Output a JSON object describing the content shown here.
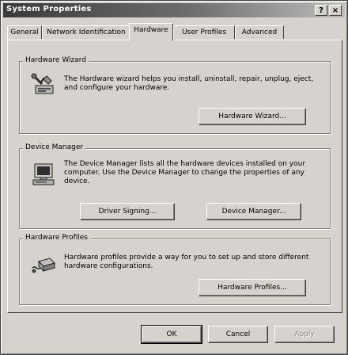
{
  "window": {
    "title": "System Properties",
    "help_label": "?",
    "close_label": "×"
  },
  "tabs": [
    {
      "label": "General",
      "active": false
    },
    {
      "label": "Network Identification",
      "active": false
    },
    {
      "label": "Hardware",
      "active": true
    },
    {
      "label": "User Profiles",
      "active": false
    },
    {
      "label": "Advanced",
      "active": false
    }
  ],
  "hardware_wizard": {
    "title": "Hardware Wizard",
    "description": "The Hardware wizard helps you install, uninstall, repair, unplug, eject, and configure your hardware.",
    "button_label": "Hardware Wizard...",
    "icon": "hardware-wizard-icon"
  },
  "device_manager": {
    "title": "Device Manager",
    "description": "The Device Manager lists all the hardware devices installed on your computer. Use the Device Manager to change the properties of any device.",
    "driver_signing_label": "Driver Signing...",
    "device_manager_label": "Device Manager...",
    "icon": "computer-icon"
  },
  "hardware_profiles": {
    "title": "Hardware Profiles",
    "description": "Hardware profiles provide a way for you to set up and store different hardware configurations.",
    "button_label": "Hardware Profiles...",
    "icon": "hardware-profiles-icon"
  },
  "footer": {
    "ok_label": "OK",
    "cancel_label": "Cancel",
    "apply_label": "Apply",
    "apply_enabled": false
  },
  "colors": {
    "dialog_face": "#d6d3ce",
    "titlebar_dark": "#3a3a3a",
    "titlebar_light": "#bdbdbd"
  }
}
